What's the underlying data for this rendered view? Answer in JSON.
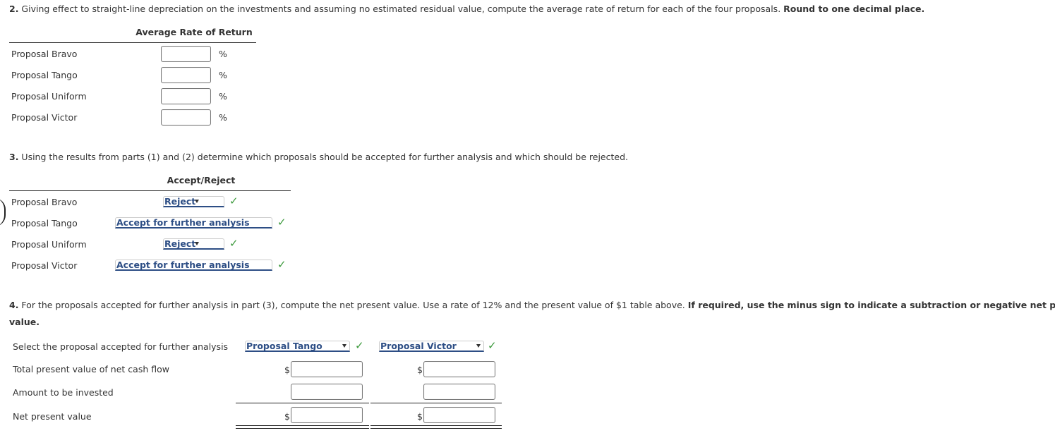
{
  "q2": {
    "number": "2.",
    "text": " Giving effect to straight-line depreciation on the investments and assuming no estimated residual value, compute the average rate of return for each of the four proposals. ",
    "bold_text": "Round to one decimal place.",
    "column_header": "Average Rate of Return",
    "unit": "%",
    "rows": [
      {
        "label": "Proposal Bravo",
        "value": ""
      },
      {
        "label": "Proposal Tango",
        "value": ""
      },
      {
        "label": "Proposal Uniform",
        "value": ""
      },
      {
        "label": "Proposal Victor",
        "value": ""
      }
    ]
  },
  "q3": {
    "number": "3.",
    "text": " Using the results from parts (1) and (2) determine which proposals should be accepted for further analysis and which should be rejected.",
    "column_header": "Accept/Reject",
    "rows": [
      {
        "label": "Proposal Bravo",
        "selected": "Reject",
        "status": "correct"
      },
      {
        "label": "Proposal Tango",
        "selected": "Accept for further analysis",
        "status": "correct"
      },
      {
        "label": "Proposal Uniform",
        "selected": "Reject",
        "status": "correct"
      },
      {
        "label": "Proposal Victor",
        "selected": "Accept for further analysis",
        "status": "correct"
      }
    ],
    "check_icon": "✓"
  },
  "q4": {
    "number": "4.",
    "text": " For the proposals accepted for further analysis in part (3), compute the net present value. Use a rate of 12% and the present value of $1 table above. ",
    "bold_text": "If required, use the minus sign to indicate a subtraction or negative net present",
    "bold_text_cont": "value.",
    "row_labels": {
      "select": "Select the proposal accepted for further analysis",
      "total_pv": "Total present value of net cash flow",
      "invested": "Amount to be invested",
      "npv": "Net present value"
    },
    "currency": "$",
    "columns": [
      {
        "selected": "Proposal Tango",
        "status": "correct",
        "total_pv": "",
        "invested": "",
        "npv": ""
      },
      {
        "selected": "Proposal Victor",
        "status": "correct",
        "total_pv": "",
        "invested": "",
        "npv": ""
      }
    ],
    "check_icon": "✓"
  },
  "colors": {
    "select_text": "#2d4e85",
    "check": "#3d9a3d",
    "text": "#333333"
  }
}
